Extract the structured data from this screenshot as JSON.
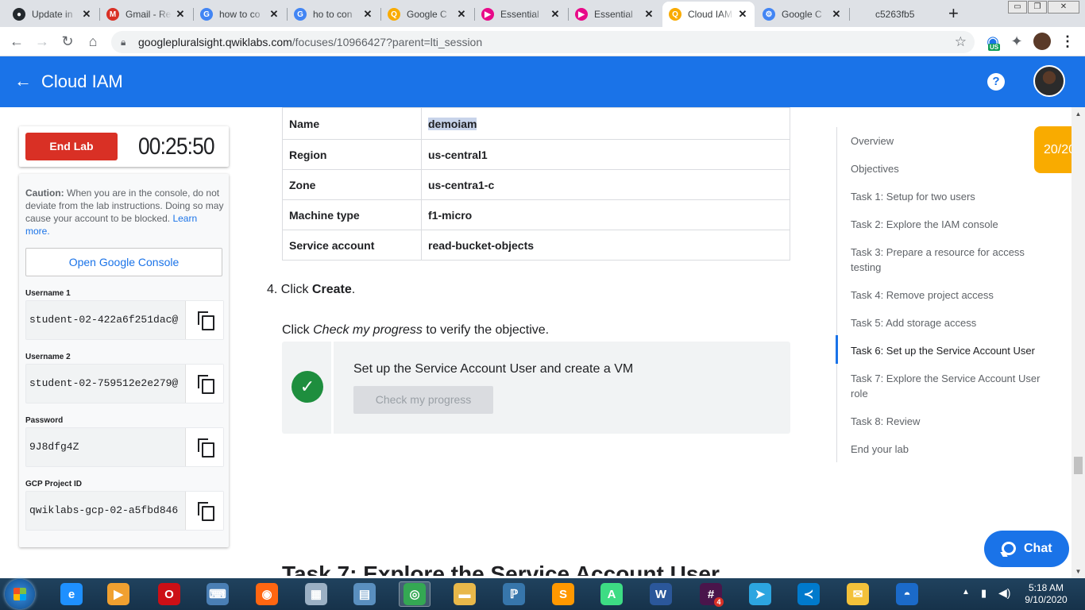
{
  "browser": {
    "tabs": [
      {
        "label": "Update in",
        "icon": "github-icon",
        "color": "#24292e",
        "glyph": "●"
      },
      {
        "label": "Gmail - Re",
        "icon": "gmail-icon",
        "color": "#d93025",
        "glyph": "M"
      },
      {
        "label": "how to co",
        "icon": "google-icon",
        "color": "#4285f4",
        "glyph": "G"
      },
      {
        "label": "ho to con",
        "icon": "google-icon",
        "color": "#4285f4",
        "glyph": "G"
      },
      {
        "label": "Google C",
        "icon": "qwiklabs-icon",
        "color": "#f9ab00",
        "glyph": "Q"
      },
      {
        "label": "Essential",
        "icon": "pluralsight-icon",
        "color": "#e80a89",
        "glyph": "▶"
      },
      {
        "label": "Essential",
        "icon": "pluralsight-icon",
        "color": "#e80a89",
        "glyph": "▶"
      },
      {
        "label": "Cloud IAM",
        "icon": "qwiklabs-icon",
        "color": "#f9ab00",
        "glyph": "Q"
      },
      {
        "label": "Google C",
        "icon": "gcp-chip-icon",
        "color": "#4285f4",
        "glyph": "⚙"
      },
      {
        "label": "c5263fb5",
        "icon": "blank-page-icon",
        "color": "#ffffff",
        "glyph": ""
      }
    ],
    "active_tab_index": 7,
    "new_tab_label": "+",
    "window_controls": [
      "▭",
      "❐",
      "✕"
    ],
    "url_host": "googlepluralsight.qwiklabs.com",
    "url_path": "/focuses/10966427?parent=lti_session",
    "extension_badge": "US"
  },
  "app": {
    "title": "Cloud IAM",
    "help_label": "?",
    "back_label": "←"
  },
  "lab": {
    "end_button": "End Lab",
    "timer": "00:25:50",
    "caution_bold": "Caution:",
    "caution_text": " When you are in the console, do not deviate from the lab instructions. Doing so may cause your account to be blocked. ",
    "learn_more": "Learn more.",
    "open_console": "Open Google Console",
    "credentials": [
      {
        "label": "Username 1",
        "value": "student-02-422a6f251dac@"
      },
      {
        "label": "Username 2",
        "value": "student-02-759512e2e279@"
      },
      {
        "label": "Password",
        "value": "9J8dfg4Z"
      },
      {
        "label": "GCP Project ID",
        "value": "qwiklabs-gcp-02-a5fbd846"
      }
    ]
  },
  "content": {
    "table": [
      {
        "key": "Name",
        "value": "demoiam",
        "selected": true
      },
      {
        "key": "Region",
        "value": "us-central1"
      },
      {
        "key": "Zone",
        "value": "us-centra1-c"
      },
      {
        "key": "Machine type",
        "value": "f1-micro"
      },
      {
        "key": "Service account",
        "value": "read-bucket-objects"
      }
    ],
    "step_number": "4. Click ",
    "step_bold": "Create",
    "step_end": ".",
    "check_prefix": "Click ",
    "check_italic": "Check my progress",
    "check_suffix": " to verify the objective.",
    "objective_title": "Set up the Service Account User and create a VM",
    "objective_button": "Check my progress",
    "next_heading": "Task 7: Explore the Service Account User"
  },
  "toc": {
    "items": [
      "Overview",
      "Objectives",
      "Task 1: Setup for two users",
      "Task 2: Explore the IAM console",
      "Task 3: Prepare a resource for access testing",
      "Task 4: Remove project access",
      "Task 5: Add storage access",
      "Task 6: Set up the Service Account User",
      "Task 7: Explore the Service Account User role",
      "Task 8: Review",
      "End your lab"
    ],
    "active_index": 7
  },
  "score": "20/20",
  "chat_label": "Chat",
  "taskbar": {
    "apps": [
      {
        "name": "internet-explorer-icon",
        "color": "#1e90ff",
        "glyph": "e"
      },
      {
        "name": "media-player-icon",
        "color": "#f0a030",
        "glyph": "▶"
      },
      {
        "name": "opera-icon",
        "color": "#cc0f16",
        "glyph": "O"
      },
      {
        "name": "network-computer-icon",
        "color": "#4a7fb5",
        "glyph": "⌨"
      },
      {
        "name": "firefox-icon",
        "color": "#ff6611",
        "glyph": "◉"
      },
      {
        "name": "calculator-icon",
        "color": "#9bb0c4",
        "glyph": "▦"
      },
      {
        "name": "remote-desktop-icon",
        "color": "#5a8fbf",
        "glyph": "▤"
      },
      {
        "name": "chrome-icon",
        "color": "#34a853",
        "glyph": "◎"
      },
      {
        "name": "file-explorer-icon",
        "color": "#e8b84a",
        "glyph": "▬"
      },
      {
        "name": "python-icon",
        "color": "#3776ab",
        "glyph": "ℙ"
      },
      {
        "name": "sublime-text-icon",
        "color": "#ff9800",
        "glyph": "S"
      },
      {
        "name": "android-studio-icon",
        "color": "#3ddc84",
        "glyph": "A"
      },
      {
        "name": "word-icon",
        "color": "#2b579a",
        "glyph": "W"
      },
      {
        "name": "slack-icon",
        "color": "#4a154b",
        "glyph": "#"
      },
      {
        "name": "telegram-icon",
        "color": "#2ca5e0",
        "glyph": "➤"
      },
      {
        "name": "vscode-icon",
        "color": "#007acc",
        "glyph": "≺"
      },
      {
        "name": "outlook-icon",
        "color": "#f3c13a",
        "glyph": "✉"
      },
      {
        "name": "screenshot-tool-icon",
        "color": "#1b6ac9",
        "glyph": "◓"
      }
    ],
    "running_index": 7,
    "slack_badge": "4",
    "clock_time": "5:18 AM",
    "clock_date": "9/10/2020"
  }
}
